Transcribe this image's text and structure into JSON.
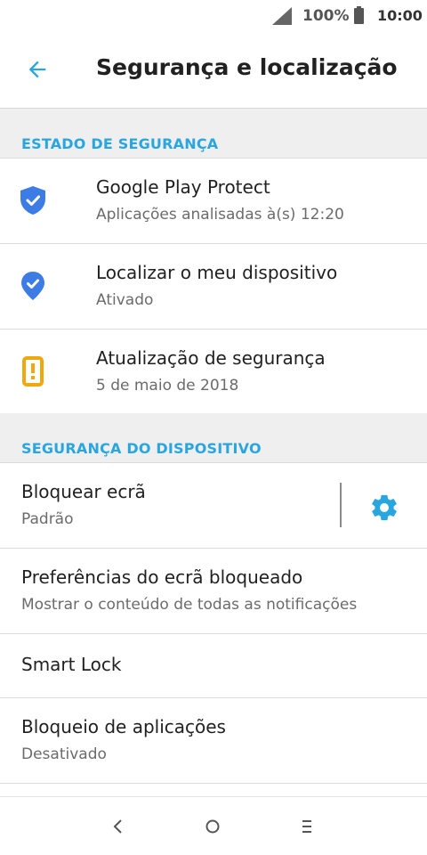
{
  "status_bar": {
    "signal_icon": "signal-icon",
    "battery_percent": "100%",
    "battery_icon": "battery-icon",
    "time": "10:00"
  },
  "app_bar": {
    "back_icon": "arrow-back-icon",
    "title": "Segurança e localização"
  },
  "colors": {
    "accent": "#29a6e0",
    "shield": "#3d7be5",
    "warning": "#f0a80f",
    "section_bg": "#efefef"
  },
  "sections": [
    {
      "header": "ESTADO DE SEGURANÇA",
      "items": [
        {
          "title": "Google Play Protect",
          "subtitle": "Aplicações analisadas à(s) 12:20",
          "icon": "shield-check-icon"
        },
        {
          "title": "Localizar o meu dispositivo",
          "subtitle": "Ativado",
          "icon": "location-check-icon"
        },
        {
          "title": "Atualização de segurança",
          "subtitle": "5 de maio de 2018",
          "icon": "phone-alert-icon"
        }
      ]
    },
    {
      "header": "SEGURANÇA DO DISPOSITIVO",
      "items": [
        {
          "title": "Bloquear ecrã",
          "subtitle": "Padrão",
          "action_icon": "gear-icon"
        },
        {
          "title": "Preferências do ecrã bloqueado",
          "subtitle": "Mostrar o conteúdo de todas as notificações"
        },
        {
          "title": "Smart Lock"
        },
        {
          "title": "Bloqueio de aplicações",
          "subtitle": "Desativado"
        }
      ]
    }
  ],
  "nav_bar": {
    "back_icon": "nav-back-icon",
    "home_icon": "nav-home-icon",
    "menu_icon": "nav-menu-icon"
  }
}
